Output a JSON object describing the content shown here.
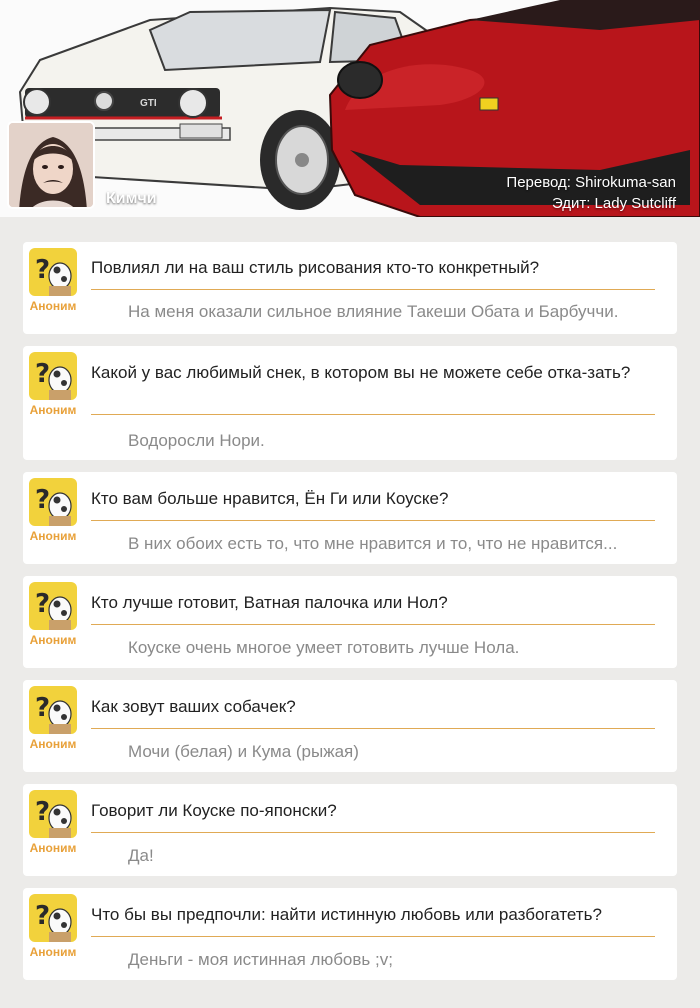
{
  "header": {
    "author_name": "Кимчи",
    "translator": "Перевод: Shirokuma-san",
    "editor": "Эдит: Lady Sutcliff",
    "white_car_badge": "GTI"
  },
  "anon_label": "Аноним",
  "colors": {
    "anon_icon_bg": "#f2d23c",
    "anon_label": "#e8a13a",
    "divider": "#e0aa55",
    "answer_text": "#8a8a8a",
    "red_car": "#b8151b"
  },
  "qa": [
    {
      "question": "Повлиял ли на ваш стиль рисования кто-то конкретный?",
      "answer": "На меня оказали сильное влияние Такеши Обата и Барбуччи."
    },
    {
      "question": "Какой у вас любимый снек, в котором вы не можете себе отка-зать?",
      "answer": "Водоросли Нори."
    },
    {
      "question": "Кто вам больше нравится, Ён Ги или Коуске?",
      "answer": "В них обоих есть то, что мне нравится и то, что не нравится..."
    },
    {
      "question": "Кто лучше готовит, Ватная палочка или Нол?",
      "answer": "Коуске очень многое умеет готовить лучше Нола."
    },
    {
      "question": "Как зовут ваших собачек?",
      "answer": "Мочи (белая) и Кума (рыжая)"
    },
    {
      "question": "Говорит ли Коуске по-японски?",
      "answer": "Да!"
    },
    {
      "question": "Что бы вы предпочли: найти истинную любовь или разбогатеть?",
      "answer": "Деньги - моя истинная любовь ;v;"
    }
  ]
}
